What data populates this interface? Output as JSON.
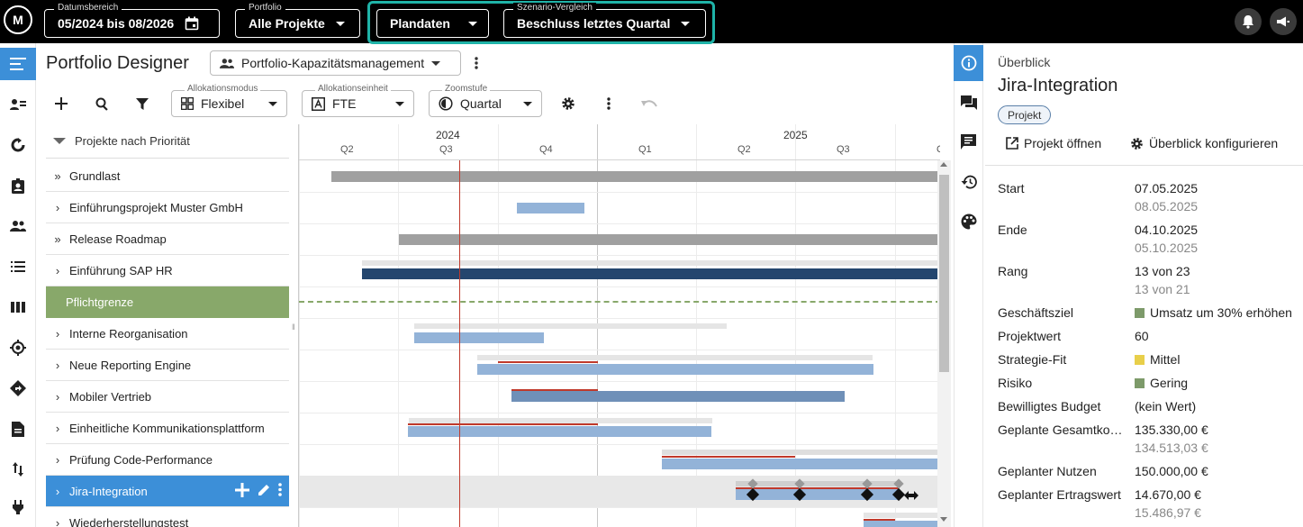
{
  "topbar": {
    "logo_text": "M",
    "date_range": {
      "label": "Datumsbereich",
      "value": "05/2024 bis 08/2026"
    },
    "portfolio": {
      "label": "Portfolio",
      "value": "Alle Projekte"
    },
    "data_source": {
      "value": "Plandaten"
    },
    "scenario": {
      "label": "Szenario-Vergleich",
      "value": "Beschluss letztes Quartal"
    },
    "highlight_color": "#1fb3a8"
  },
  "nav": {
    "items": [
      "menu-icon",
      "person-list-icon",
      "refresh-icon",
      "contact-card-icon",
      "group-icon",
      "list-icon",
      "columns-icon",
      "target-icon",
      "route-icon",
      "document-icon",
      "sort-arrows-icon",
      "plug-icon"
    ],
    "active_color": "#3c8fd8"
  },
  "header": {
    "title": "Portfolio Designer",
    "view_select": "Portfolio-Kapazitätsmanagement"
  },
  "toolbar": {
    "allocation_mode": {
      "label": "Allokationsmodus",
      "value": "Flexibel"
    },
    "allocation_unit": {
      "label": "Allokationseinheit",
      "value": "FTE"
    },
    "zoom": {
      "label": "Zoomstufe",
      "value": "Quartal"
    }
  },
  "list": {
    "header": "Projekte nach Priorität",
    "rows": [
      {
        "label": "Grundlast",
        "chevron": "»"
      },
      {
        "label": "Einführungsprojekt Muster GmbH",
        "chevron": "›"
      },
      {
        "label": "Release Roadmap",
        "chevron": "»"
      },
      {
        "label": "Einführung SAP HR",
        "chevron": "›"
      },
      {
        "label": "Pflichtgrenze",
        "chevron": ""
      },
      {
        "label": "Interne Reorganisation",
        "chevron": "›"
      },
      {
        "label": "Neue Reporting Engine",
        "chevron": "›"
      },
      {
        "label": "Mobiler Vertrieb",
        "chevron": "›"
      },
      {
        "label": "Einheitliche Kommunikationsplattform",
        "chevron": "›"
      },
      {
        "label": "Prüfung Code-Performance",
        "chevron": "›"
      },
      {
        "label": "Jira-Integration",
        "chevron": "›"
      },
      {
        "label": "Wiederherstellungstest",
        "chevron": "›"
      }
    ]
  },
  "timeline": {
    "years": [
      "2024",
      "2025"
    ],
    "quarters": [
      "Q2",
      "Q3",
      "Q4",
      "Q1",
      "Q2",
      "Q3",
      "Q4"
    ],
    "today_color": "#c0392b",
    "colors": {
      "grey": "#a0a0a0",
      "blue_light": "#93b3d8",
      "blue_dark": "#24466e",
      "blue_mid": "#6f90b8",
      "baseline": "#e5e5e5",
      "threshold": "#88a86a"
    }
  },
  "panel": {
    "overline": "Überblick",
    "title": "Jira-Integration",
    "chip": "Projekt",
    "open_project": "Projekt öffnen",
    "configure": "Überblick konfigurieren",
    "fields": [
      {
        "key": "Start",
        "value": "07.05.2025",
        "sub": "08.05.2025"
      },
      {
        "key": "Ende",
        "value": "04.10.2025",
        "sub": "05.10.2025"
      },
      {
        "key": "Rang",
        "value": "13 von 23",
        "sub": "13 von 21"
      },
      {
        "key": "Geschäftsziel",
        "value": "Umsatz um 30% erhöhen",
        "color": "#7d9a6a"
      },
      {
        "key": "Projektwert",
        "value": "60"
      },
      {
        "key": "Strategie-Fit",
        "value": "Mittel",
        "color": "#e8cf4a"
      },
      {
        "key": "Risiko",
        "value": "Gering",
        "color": "#7d9a6a"
      },
      {
        "key": "Bewilligtes Budget",
        "value": "(kein Wert)"
      },
      {
        "key": "Geplante Gesamtkosten",
        "value": "135.330,00 €",
        "sub": "134.513,03 €"
      },
      {
        "key": "Geplanter Nutzen",
        "value": "150.000,00 €"
      },
      {
        "key": "Geplanter Ertragswert",
        "value": "14.670,00 €",
        "sub": "15.486,97 €"
      }
    ]
  }
}
